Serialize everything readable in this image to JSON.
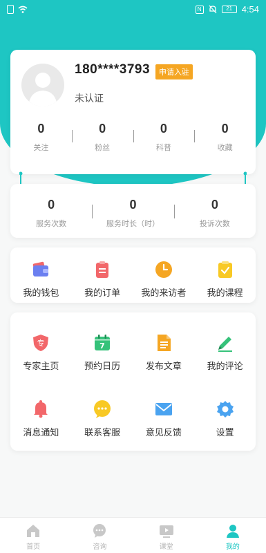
{
  "status_bar": {
    "time": "4:54",
    "battery": "21"
  },
  "profile": {
    "phone": "180****3793",
    "apply_badge": "申请入驻",
    "verify_status": "未认证",
    "stats": [
      {
        "value": "0",
        "label": "关注"
      },
      {
        "value": "0",
        "label": "粉丝"
      },
      {
        "value": "0",
        "label": "科普"
      },
      {
        "value": "0",
        "label": "收藏"
      }
    ]
  },
  "service": {
    "stats": [
      {
        "value": "0",
        "label": "服务次数"
      },
      {
        "value": "0",
        "label": "服务时长（时）"
      },
      {
        "value": "0",
        "label": "投诉次数"
      }
    ]
  },
  "menu_primary": [
    {
      "label": "我的钱包",
      "icon": "wallet-icon"
    },
    {
      "label": "我的订单",
      "icon": "order-icon"
    },
    {
      "label": "我的来访者",
      "icon": "clock-icon"
    },
    {
      "label": "我的课程",
      "icon": "course-icon"
    }
  ],
  "menu_secondary": [
    {
      "label": "专家主页",
      "icon": "expert-shield-icon"
    },
    {
      "label": "预约日历",
      "icon": "calendar-icon"
    },
    {
      "label": "发布文章",
      "icon": "document-icon"
    },
    {
      "label": "我的评论",
      "icon": "pencil-icon"
    },
    {
      "label": "消息通知",
      "icon": "bell-icon"
    },
    {
      "label": "联系客服",
      "icon": "chat-bubble-icon"
    },
    {
      "label": "意见反馈",
      "icon": "envelope-icon"
    },
    {
      "label": "设置",
      "icon": "gear-icon"
    }
  ],
  "tabbar": [
    {
      "label": "首页",
      "icon": "home-icon",
      "active": false
    },
    {
      "label": "咨询",
      "icon": "consult-icon",
      "active": false
    },
    {
      "label": "课堂",
      "icon": "video-icon",
      "active": false
    },
    {
      "label": "我的",
      "icon": "profile-icon",
      "active": true
    }
  ],
  "colors": {
    "accent": "#1ec6c3",
    "badge": "#f5a623"
  }
}
